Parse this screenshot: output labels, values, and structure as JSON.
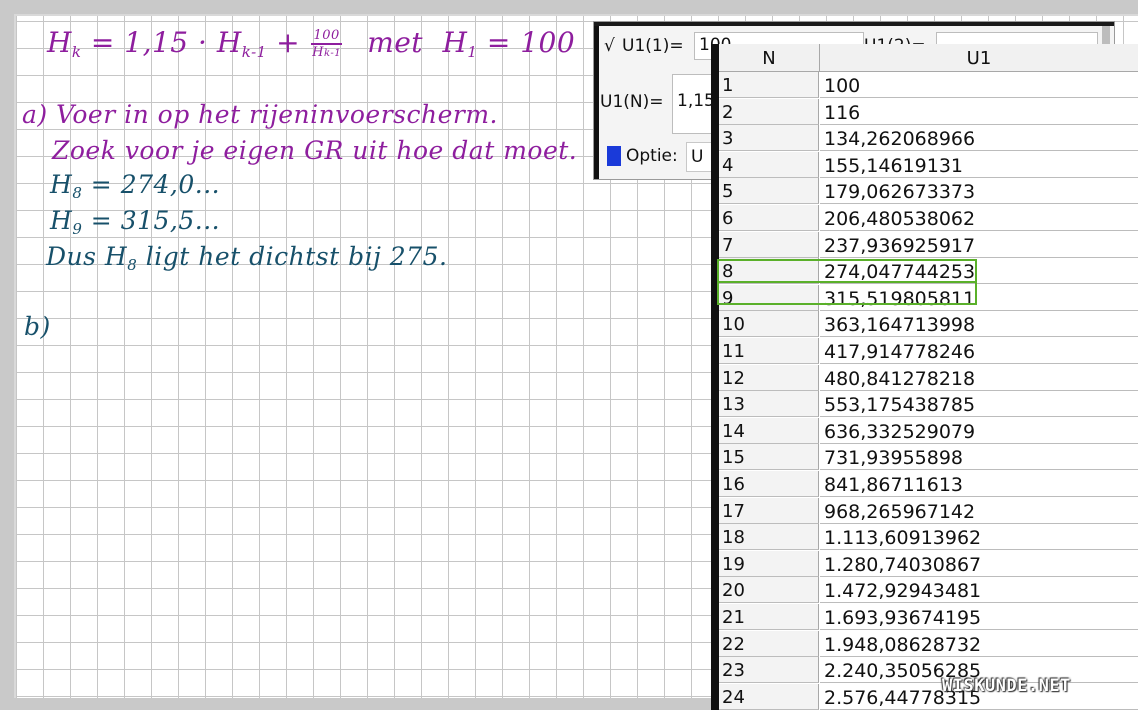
{
  "notes": {
    "formula": {
      "lhs": "H",
      "lhs_sub": "k",
      "eq": " = 1,15 · H",
      "mid_sub": "k-1",
      "plus": " + ",
      "frac_num": "100",
      "frac_den": "H",
      "frac_den_sub": "k-1",
      "met": "met",
      "init": "H",
      "init_sub": "1",
      "init_rest": " = 100"
    },
    "part_a_label": "a)",
    "part_a_line1": "Voer in op het rijeninvoerscherm.",
    "part_a_line2": "Zoek voor je eigen GR uit hoe dat moet.",
    "h8_label": "H",
    "h8_sub": "8",
    "h8_value": " = 274,0...",
    "h9_label": "H",
    "h9_sub": "9",
    "h9_value": " = 315,5...",
    "conclusion_pre": "Dus H",
    "conclusion_sub": "8",
    "conclusion_post": " ligt het dichtst bij 275.",
    "part_b_label": "b)"
  },
  "calculator": {
    "check_mark": "√",
    "u1_1_label": "U1(1)=",
    "u1_1_value": "100",
    "u1_2_label": "U1(2)=",
    "u1n_label": "U1(N)=",
    "u1n_value": "1,15",
    "optie_label": "Optie:",
    "optie_value": "U"
  },
  "table": {
    "headers": [
      "N",
      "U1"
    ],
    "rows": [
      [
        "1",
        "100"
      ],
      [
        "2",
        "116"
      ],
      [
        "3",
        "134,262068966"
      ],
      [
        "4",
        "155,14619131"
      ],
      [
        "5",
        "179,062673373"
      ],
      [
        "6",
        "206,480538062"
      ],
      [
        "7",
        "237,936925917"
      ],
      [
        "8",
        "274,047744253"
      ],
      [
        "9",
        "315,519805811"
      ],
      [
        "10",
        "363,164713998"
      ],
      [
        "11",
        "417,914778246"
      ],
      [
        "12",
        "480,841278218"
      ],
      [
        "13",
        "553,175438785"
      ],
      [
        "14",
        "636,332529079"
      ],
      [
        "15",
        "731,93955898"
      ],
      [
        "16",
        "841,86711613"
      ],
      [
        "17",
        "968,265967142"
      ],
      [
        "18",
        "1.113,60913962"
      ],
      [
        "19",
        "1.280,74030867"
      ],
      [
        "20",
        "1.472,92943481"
      ],
      [
        "21",
        "1.693,93674195"
      ],
      [
        "22",
        "1.948,08628732"
      ],
      [
        "23",
        "2.240,35056285"
      ],
      [
        "24",
        "2.576,44778315"
      ]
    ]
  },
  "watermark": "WISKUNDE.NET",
  "colors": {
    "purple_ink": "#8e1e9e",
    "teal_ink": "#17506a",
    "highlight": "#5ab02a"
  }
}
